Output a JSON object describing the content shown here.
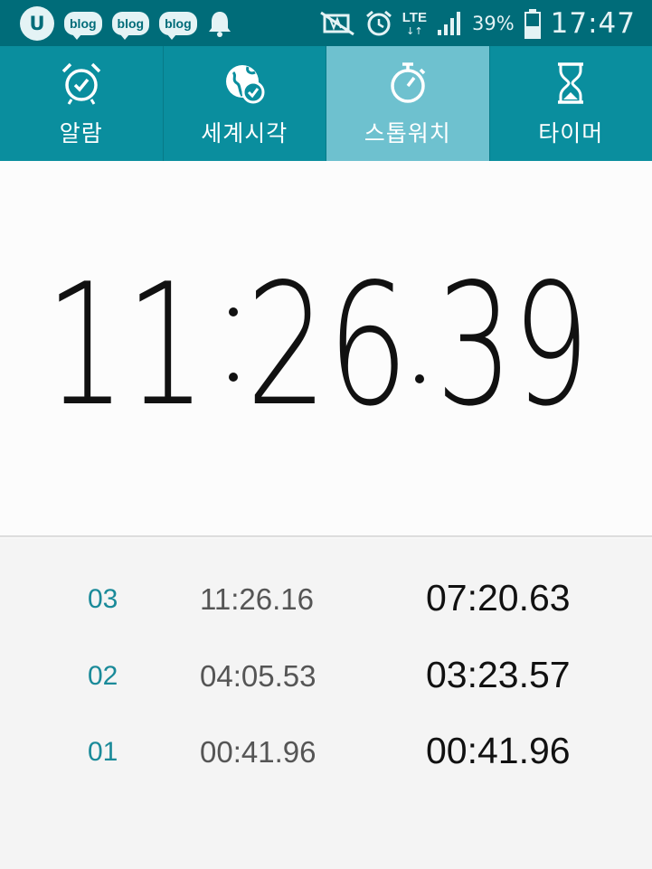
{
  "status_bar": {
    "app_glyph": "U",
    "blog_badges": [
      "blog",
      "blog",
      "blog"
    ],
    "network": "LTE",
    "network_arrows": "↓↑",
    "battery": "39%",
    "time": "17:47",
    "icons": [
      "notification-bell-icon",
      "mute-icon",
      "alarm-clock-icon",
      "signal-icon",
      "battery-icon"
    ]
  },
  "tabs": [
    {
      "label": "알람",
      "icon": "alarm-icon",
      "active": false
    },
    {
      "label": "세계시각",
      "icon": "world-clock-icon",
      "active": false
    },
    {
      "label": "스톱워치",
      "icon": "stopwatch-icon",
      "active": true
    },
    {
      "label": "타이머",
      "icon": "hourglass-icon",
      "active": false
    }
  ],
  "stopwatch": {
    "minutes": "11",
    "seconds": "26",
    "hundredths": "39"
  },
  "laps": [
    {
      "number": "03",
      "total": "11:26.16",
      "split": "07:20.63"
    },
    {
      "number": "02",
      "total": "04:05.53",
      "split": "03:23.57"
    },
    {
      "number": "01",
      "total": "00:41.96",
      "split": "00:41.96"
    }
  ],
  "colors": {
    "status_bar": "#006c79",
    "tab_bar": "#0a8e9e",
    "tab_active": "#6ec1cf",
    "lap_number": "#1a8a99"
  }
}
